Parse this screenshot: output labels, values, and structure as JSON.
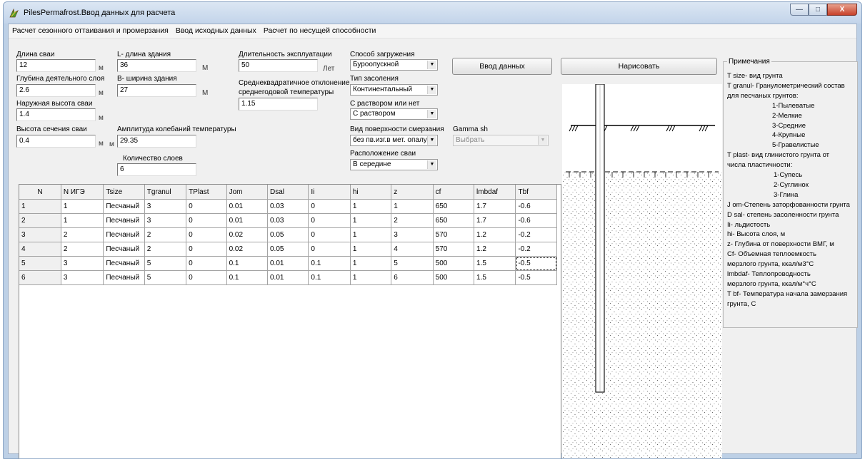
{
  "window": {
    "title": "PilesPermafrost.Ввод данных для расчета",
    "minimize_symbol": "—",
    "maximize_symbol": "□",
    "close_symbol": "X"
  },
  "menu": [
    "Расчет сезонного оттаивания и промерзания",
    "Ввод исходных данных",
    "Расчет по несущей способности"
  ],
  "form": {
    "pile_length": {
      "label": "Длина сваи",
      "value": "12",
      "unit": "м"
    },
    "active_layer_depth": {
      "label": "Глубина деятельного слоя",
      "value": "2.6",
      "unit": "м"
    },
    "pile_outer_height": {
      "label": "Наружная высота сваи",
      "value": "1.4",
      "unit": "м"
    },
    "pile_section_height": {
      "label": "Высота сечения сваи",
      "value": "0.4",
      "unit": "м"
    },
    "building_length": {
      "label": "L- длина здания",
      "value": "36",
      "unit": "М"
    },
    "building_width": {
      "label": "В- ширина здания",
      "value": "27",
      "unit": "М"
    },
    "temp_amplitude": {
      "label": "Амплитуда колебаний температуры",
      "value": "29.35",
      "unit": "м"
    },
    "layer_count": {
      "label": "Количество слоев",
      "value": "6"
    },
    "service_duration": {
      "label": "Длительность эксплуатации",
      "value": "50",
      "unit": "Лет"
    },
    "std_deviation": {
      "label_line1": "Среднеквадратичное отклонение",
      "label_line2": "среднегодовой температуры",
      "value": "1.15"
    },
    "loading_method": {
      "label": "Способ загружения",
      "value": "Буроопускной"
    },
    "salinity_type": {
      "label": "Тип засоления",
      "value": "Континентальный"
    },
    "mortar": {
      "label": "С раствором или нет",
      "value": "С раствором"
    },
    "freeze_surface": {
      "label": "Вид поверхности смерзания",
      "value": "без пв.изг.в мет. опалуб"
    },
    "gamma_sh": {
      "label": "Gamma sh",
      "value": "Выбрать"
    },
    "pile_position": {
      "label": "Расположение сваи",
      "value": "В середине"
    }
  },
  "buttons": {
    "input_data": "Ввод данных",
    "draw": "Нарисовать"
  },
  "table": {
    "columns": [
      "N",
      "N ИГЭ",
      "Tsize",
      "Tgranul",
      "TPlast",
      "Jom",
      "Dsal",
      "Ii",
      "hi",
      "z",
      "cf",
      "lmbdaf",
      "Tbf"
    ],
    "rows": [
      [
        "1",
        "1",
        "Песчаный",
        "3",
        "0",
        "0.01",
        "0.03",
        "0",
        "1",
        "1",
        "650",
        "1.7",
        "-0.6"
      ],
      [
        "2",
        "1",
        "Песчаный",
        "3",
        "0",
        "0.01",
        "0.03",
        "0",
        "1",
        "2",
        "650",
        "1.7",
        "-0.6"
      ],
      [
        "3",
        "2",
        "Песчаный",
        "2",
        "0",
        "0.02",
        "0.05",
        "0",
        "1",
        "3",
        "570",
        "1.2",
        "-0.2"
      ],
      [
        "4",
        "2",
        "Песчаный",
        "2",
        "0",
        "0.02",
        "0.05",
        "0",
        "1",
        "4",
        "570",
        "1.2",
        "-0.2"
      ],
      [
        "5",
        "3",
        "Песчаный",
        "5",
        "0",
        "0.1",
        "0.01",
        "0.1",
        "1",
        "5",
        "500",
        "1.5",
        "-0.5"
      ],
      [
        "6",
        "3",
        "Песчаный",
        "5",
        "0",
        "0.1",
        "0.01",
        "0.1",
        "1",
        "6",
        "500",
        "1.5",
        "-0.5"
      ]
    ]
  },
  "notes": {
    "title": "Примечания",
    "lines": [
      "T size- вид грунта",
      "T granul- Гранулометрический состав",
      "для песчаных грунтов:",
      "1-Пылеватые",
      "2-Мелкие",
      "3-Средние",
      "4-Крупные",
      "5-Гравелистые",
      "T plast- вид глинистого грунта от",
      "числа пластичности:",
      "1-Супесь",
      "2-Суглинок",
      "3-Глина",
      "J om-Степень заторфованности грунта",
      "D sal- степень засоленности грунта",
      "Ii- льдистость",
      "hi- Высота слоя, м",
      "z- Глубина от поверхности ВМГ, м",
      "Cf- Объемная теплоемкость",
      "мерзлого грунта, ккал/м3°С",
      "lmbdaf- Теплопроводность",
      "мерзлого грунта, ккал/м°ч°С",
      "T bf- Температура начала замерзания",
      "грунта, С"
    ]
  },
  "colors": {
    "title_bar": "#c3d4ea",
    "close_button": "#c8412a",
    "client_bg": "#f0f0f0"
  }
}
